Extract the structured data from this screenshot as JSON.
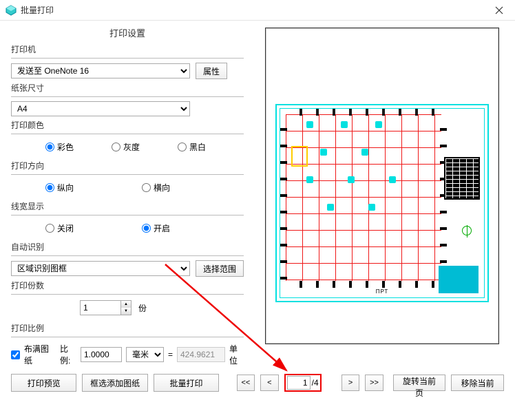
{
  "window": {
    "title": "批量打印"
  },
  "settings_heading": "打印设置",
  "printer": {
    "label": "打印机",
    "selected": "发送至 OneNote 16",
    "properties_btn": "属性"
  },
  "paper": {
    "label": "纸张尺寸",
    "selected": "A4"
  },
  "color": {
    "label": "打印颜色",
    "options": {
      "color": "彩色",
      "gray": "灰度",
      "bw": "黑白"
    },
    "value": "color"
  },
  "orientation": {
    "label": "打印方向",
    "options": {
      "portrait": "纵向",
      "landscape": "横向"
    },
    "value": "portrait"
  },
  "lineweight": {
    "label": "线宽显示",
    "options": {
      "off": "关闭",
      "on": "开启"
    },
    "value": "on"
  },
  "auto_detect": {
    "label": "自动识别",
    "selected": "区域识别图框",
    "range_btn": "选择范围"
  },
  "copies": {
    "label": "打印份数",
    "value": "1",
    "unit": "份"
  },
  "scale": {
    "label": "打印比例",
    "fit_label": "布满图纸",
    "fit_checked": true,
    "ratio_label": "比例:",
    "ratio_value": "1.0000",
    "unit_selected": "毫米",
    "equals": "=",
    "out_value": "424.9621",
    "unit_label": "单位"
  },
  "bottom": {
    "preview_btn": "打印预览",
    "add_frame_btn": "框选添加图纸",
    "batch_btn": "批量打印",
    "nav_first": "<<",
    "nav_prev": "<",
    "nav_next": ">",
    "nav_last": ">>",
    "rotate_btn": "旋转当前页",
    "remove_btn": "移除当前",
    "page_current": "1",
    "page_total": "/4"
  },
  "preview": {
    "caption": "ПРТ"
  }
}
